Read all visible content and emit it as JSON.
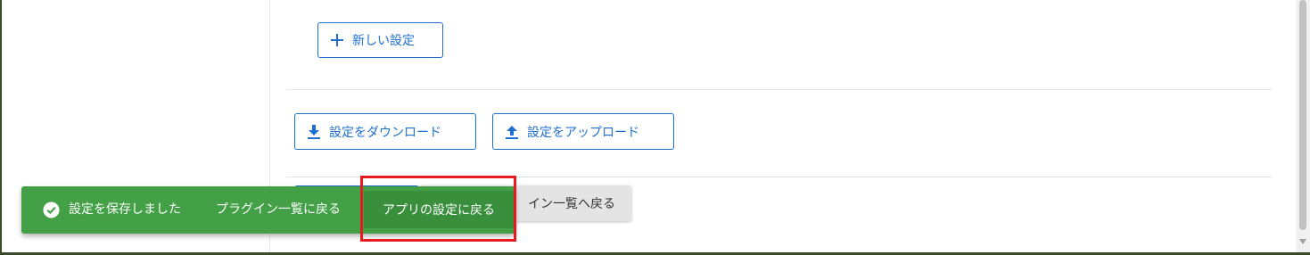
{
  "buttons": {
    "new_setting": "新しい設定",
    "download": "設定をダウンロード",
    "upload": "設定をアップロード",
    "back_to_plugins": "イン一覧へ戻る"
  },
  "toast": {
    "message": "設定を保存しました",
    "plugin_link": "プラグイン一覧に戻る",
    "app_link": "アプリの設定に戻る",
    "color": "#43a047"
  },
  "colors": {
    "accent": "#1f6fd1",
    "highlight": "#e8191f"
  },
  "icons": {
    "new_setting": "plus-icon",
    "download": "download-icon",
    "upload": "upload-icon",
    "toast": "check-circle-icon"
  }
}
